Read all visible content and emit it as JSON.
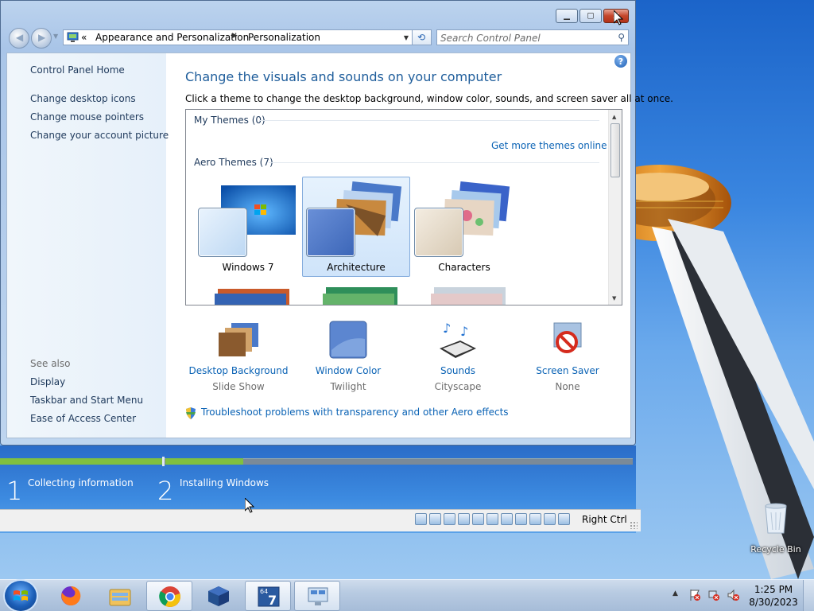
{
  "window": {
    "caption": {
      "minimize_icon": "minimize-icon",
      "maximize_icon": "maximize-icon",
      "close_icon": "close-icon",
      "close_glyph": "✕",
      "minimize_glyph": "▁",
      "maximize_glyph": "▢"
    },
    "nav": {
      "back_glyph": "◀",
      "forward_glyph": "▶",
      "address": {
        "prefix": "«",
        "crumbs": [
          "Appearance and Personalization",
          "Personalization"
        ],
        "separator": "▶"
      },
      "search_placeholder": "Search Control Panel"
    },
    "sidebar": {
      "home": "Control Panel Home",
      "links": [
        "Change desktop icons",
        "Change mouse pointers",
        "Change your account picture"
      ],
      "see_also_heading": "See also",
      "see_also": [
        "Display",
        "Taskbar and Start Menu",
        "Ease of Access Center"
      ]
    },
    "main": {
      "title": "Change the visuals and sounds on your computer",
      "description": "Click a theme to change the desktop background, window color, sounds, and screen saver all at once.",
      "my_themes_heading": "My Themes (0)",
      "get_more_link": "Get more themes online",
      "aero_heading": "Aero Themes (7)",
      "themes": [
        {
          "label": "Windows 7",
          "selected": false
        },
        {
          "label": "Architecture",
          "selected": true
        },
        {
          "label": "Characters",
          "selected": false
        }
      ],
      "settings": [
        {
          "name": "Desktop Background",
          "value": "Slide Show"
        },
        {
          "name": "Window Color",
          "value": "Twilight"
        },
        {
          "name": "Sounds",
          "value": "Cityscape"
        },
        {
          "name": "Screen Saver",
          "value": "None"
        }
      ],
      "troubleshoot_link": "Troubleshoot problems with transparency and other Aero effects",
      "help_glyph": "?"
    }
  },
  "setup": {
    "steps": [
      {
        "number": "1",
        "label": "Collecting information"
      },
      {
        "number": "2",
        "label": "Installing Windows"
      }
    ]
  },
  "vm_status": {
    "host_key": "Right Ctrl"
  },
  "desktop": {
    "recycle_bin_label": "Recycle Bin"
  },
  "taskbar": {
    "clock_time": "1:25 PM",
    "clock_date": "8/30/2023",
    "items": [
      "firefox-icon",
      "file-explorer-icon",
      "chrome-icon",
      "virtualbox-icon",
      "windows7-64-vm-icon",
      "remote-desktop-icon"
    ]
  },
  "colors": {
    "link_blue": "#0b63b5",
    "title_blue": "#1e5d9b",
    "progress_green": "#80c040"
  }
}
